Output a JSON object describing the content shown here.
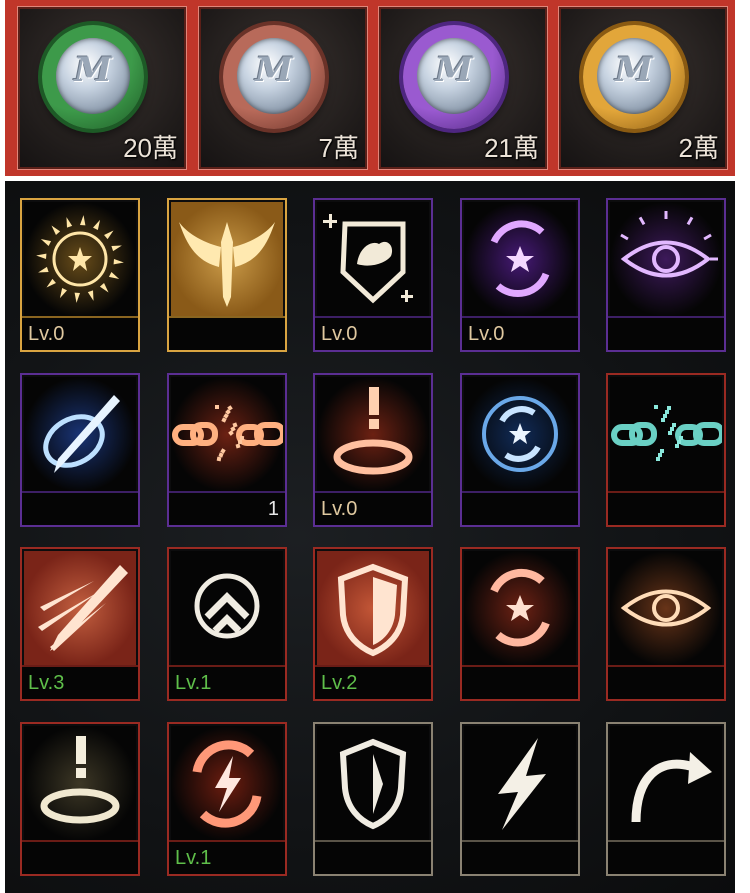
{
  "currencies": [
    {
      "name": "green-coin",
      "amount": "20萬",
      "ring": "#3d9a4a",
      "ring_dark": "#1d5a26"
    },
    {
      "name": "copper-coin",
      "amount": "7萬",
      "ring": "#b86a5a",
      "ring_dark": "#6a3228"
    },
    {
      "name": "purple-coin",
      "amount": "21萬",
      "ring": "#9a5ad0",
      "ring_dark": "#4e2680"
    },
    {
      "name": "gold-coin",
      "amount": "2萬",
      "ring": "#e2a63a",
      "ring_dark": "#8a5a12"
    }
  ],
  "coin_glyph": "M",
  "skills": [
    {
      "icon": "sun-star-icon",
      "frame": "gold",
      "level": "Lv.0",
      "count": "",
      "level_color": "#e0c9a0"
    },
    {
      "icon": "winged-sword-icon",
      "frame": "gold",
      "level": "",
      "count": "",
      "level_color": "#e0c9a0"
    },
    {
      "icon": "muscle-shield-icon",
      "frame": "purple",
      "level": "Lv.0",
      "count": "",
      "level_color": "#e0c9a0"
    },
    {
      "icon": "purple-star-cycle-icon",
      "frame": "purple",
      "level": "Lv.0",
      "count": "",
      "level_color": "#e0c9a0"
    },
    {
      "icon": "purple-eye-icon",
      "frame": "purple",
      "level": "",
      "count": "",
      "level_color": "#e0c9a0"
    },
    {
      "icon": "blue-sword-swirl-icon",
      "frame": "purple",
      "level": "",
      "count": "",
      "level_color": "#e0c9a0"
    },
    {
      "icon": "broken-chain-red-icon",
      "frame": "purple",
      "level": "",
      "count": "1",
      "level_color": "#e0c9a0"
    },
    {
      "icon": "sword-ring-red-icon",
      "frame": "purple",
      "level": "Lv.0",
      "count": "",
      "level_color": "#e0c9a0"
    },
    {
      "icon": "blue-star-gear-icon",
      "frame": "purple",
      "level": "",
      "count": "",
      "level_color": "#e0c9a0"
    },
    {
      "icon": "broken-chain-teal-icon",
      "frame": "red",
      "level": "",
      "count": "",
      "level_color": "#e0c9a0"
    },
    {
      "icon": "triple-sword-icon",
      "frame": "red",
      "level": "Lv.3",
      "count": "",
      "level_color": "#5fbf4a"
    },
    {
      "icon": "chevron-up-circle-icon",
      "frame": "red",
      "level": "Lv.1",
      "count": "",
      "level_color": "#5fbf4a"
    },
    {
      "icon": "split-shield-icon",
      "frame": "red",
      "level": "Lv.2",
      "count": "",
      "level_color": "#5fbf4a"
    },
    {
      "icon": "red-star-cycle-icon",
      "frame": "red",
      "level": "",
      "count": "",
      "level_color": "#e0c9a0"
    },
    {
      "icon": "orange-eye-icon",
      "frame": "red",
      "level": "",
      "count": "",
      "level_color": "#e0c9a0"
    },
    {
      "icon": "sword-ring-white-icon",
      "frame": "red",
      "level": "",
      "count": "",
      "level_color": "#e0c9a0"
    },
    {
      "icon": "lightning-cycle-icon",
      "frame": "red",
      "level": "Lv.1",
      "count": "",
      "level_color": "#5fbf4a"
    },
    {
      "icon": "white-shield-icon",
      "frame": "gray",
      "level": "",
      "count": "",
      "level_color": "#e0c9a0"
    },
    {
      "icon": "lightning-bolt-icon",
      "frame": "gray",
      "level": "",
      "count": "",
      "level_color": "#e0c9a0"
    },
    {
      "icon": "curved-arrow-icon",
      "frame": "gray",
      "level": "",
      "count": "",
      "level_color": "#e0c9a0"
    }
  ]
}
